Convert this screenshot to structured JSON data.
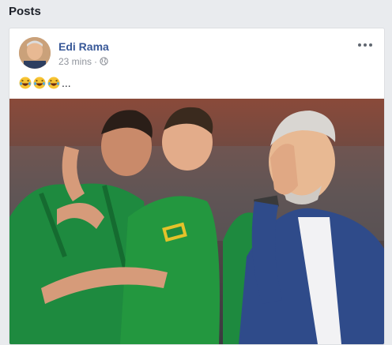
{
  "section": {
    "title": "Posts"
  },
  "post": {
    "author": "Edi Rama",
    "timestamp": "23 mins",
    "separator": "·",
    "privacy_icon": "globe-icon",
    "more_icon": "more-options-icon",
    "text_emojis": [
      "grinning-squinting-face",
      "grinning-squinting-face",
      "grinning-squinting-face"
    ],
    "text_suffix": "...",
    "photo_alt": "photo"
  },
  "colors": {
    "page_bg": "#e9ebee",
    "author_link": "#385898",
    "meta_text": "#90949c",
    "jersey_green": "#1e8a3f"
  }
}
